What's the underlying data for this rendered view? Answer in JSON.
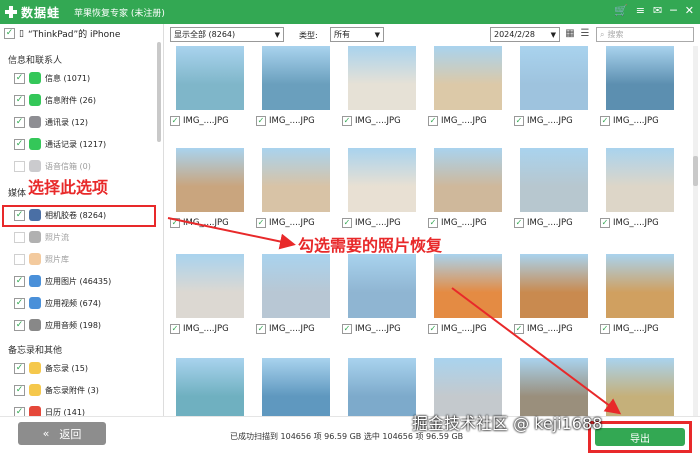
{
  "titlebar": {
    "logo_text": "数据蛙",
    "app_title": "苹果恢复专家 (未注册)",
    "icons": [
      "cart-icon",
      "menu-icon",
      "chat-icon",
      "minimize-icon",
      "close-icon"
    ],
    "accent": "#33a853"
  },
  "sidebar": {
    "device_label": "“ThinkPad”的 iPhone",
    "groups": [
      {
        "title": "信息和联系人"
      },
      {
        "title": "媒体"
      },
      {
        "title": "备忘录和其他"
      }
    ],
    "items": [
      {
        "label": "信息 (1071)",
        "checked": true,
        "icon": "message-icon",
        "color": "#34c759"
      },
      {
        "label": "信息附件 (26)",
        "checked": true,
        "icon": "message-attachment-icon",
        "color": "#34c759"
      },
      {
        "label": "通讯录 (12)",
        "checked": true,
        "icon": "contacts-icon",
        "color": "#8e8e93"
      },
      {
        "label": "通话记录 (1217)",
        "checked": true,
        "icon": "phone-icon",
        "color": "#34c759"
      },
      {
        "label": "语音信箱 (0)",
        "checked": false,
        "icon": "voicemail-icon",
        "color": "#8e8e93"
      },
      {
        "label": "相机胶卷 (8264)",
        "checked": true,
        "icon": "camera-roll-icon",
        "color": "#4a6fa5"
      },
      {
        "label": "照片流",
        "checked": false,
        "icon": "photo-stream-icon",
        "color": "#555"
      },
      {
        "label": "照片库",
        "checked": false,
        "icon": "photo-library-icon",
        "color": "#e58b2a"
      },
      {
        "label": "应用图片 (46435)",
        "checked": true,
        "icon": "app-photos-icon",
        "color": "#4a90d9"
      },
      {
        "label": "应用视频 (674)",
        "checked": true,
        "icon": "app-videos-icon",
        "color": "#4a90d9"
      },
      {
        "label": "应用音频 (198)",
        "checked": true,
        "icon": "music-icon",
        "color": "#888"
      },
      {
        "label": "备忘录 (15)",
        "checked": true,
        "icon": "notes-icon",
        "color": "#f5c84c"
      },
      {
        "label": "备忘录附件 (3)",
        "checked": true,
        "icon": "notes-attachment-icon",
        "color": "#f5c84c"
      },
      {
        "label": "日历 (141)",
        "checked": true,
        "icon": "calendar-icon",
        "color": "#e5483a"
      }
    ]
  },
  "toolbar": {
    "filter_value": "显示全部 (8264)",
    "type_label": "类型:",
    "type_value": "所有",
    "date_value": "2024/2/28",
    "search_placeholder": "搜索"
  },
  "thumbnails": {
    "caption": "IMG_....JPG",
    "rows": [
      [
        "#7fb6c9",
        "#6a9fbd",
        "#e6e1d6",
        "#dcc9a8",
        "#9ec3de",
        "#5c8fb0"
      ],
      [
        "#c9a57e",
        "#d8c3a6",
        "#e8e0d3",
        "#cfb89b",
        "#b7c7cf",
        "#ddd6c8"
      ],
      [
        "#dcd8d2",
        "#b8c7d4",
        "#8fb5d2",
        "#e48b43",
        "#c98a4f",
        "#d0a060"
      ],
      [
        "#6fb0c0",
        "#5f98bf",
        "#7daacb",
        "#c4c9cd",
        "#9a8f7c",
        "#c5b07a"
      ]
    ]
  },
  "annotations": {
    "select_option": "选择此选项",
    "check_photos": "勾选需要的照片恢复"
  },
  "bottom": {
    "back_label": "返回",
    "status_text": "已成功扫描到 104656 项 96.59 GB  选中 104656 项 96.59 GB",
    "export_label": "导出",
    "watermark": "掘金技术社区 @ keji1688"
  }
}
